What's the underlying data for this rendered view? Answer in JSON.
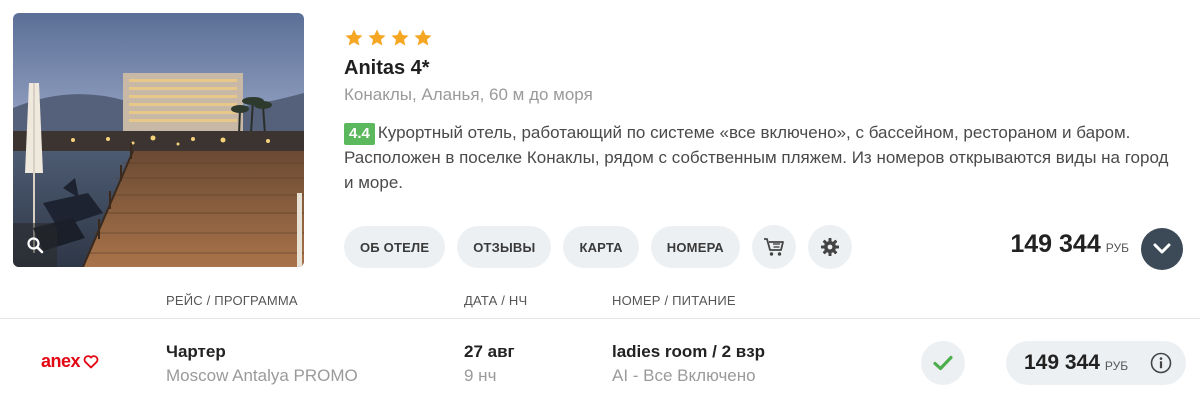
{
  "hotel": {
    "stars": 4,
    "name": "Anitas 4*",
    "location": "Конаклы, Аланья, 60 м до моря",
    "rating": "4.4",
    "description": "Курортный отель, работающий по системе «все включено», с бассейном, рестораном и баром. Расположен в поселке Конаклы, рядом с собственным пляжем. Из номеров открываются виды на город и море.",
    "photo_icon": "search-icon"
  },
  "actions": {
    "about": "ОБ ОТЕЛЕ",
    "reviews": "ОТЗЫВЫ",
    "map": "КАРТА",
    "rooms": "НОМЕРА",
    "cart_icon": "cart-icon",
    "settings_icon": "gear-icon"
  },
  "price": {
    "amount": "149 344",
    "currency": "РУБ"
  },
  "columns": {
    "flight": "РЕЙС / ПРОГРАММА",
    "date": "ДАТА / НЧ",
    "room": "НОМЕР / ПИТАНИЕ"
  },
  "offer": {
    "operator": "anex",
    "flight_type": "Чартер",
    "program": "Moscow Antalya PROMO",
    "date": "27 авг",
    "nights": "9 нч",
    "room": "ladies room / 2 взр",
    "meal": "AI - Все Включено",
    "price": "149 344",
    "currency": "РУБ"
  },
  "colors": {
    "star": "#f5a623",
    "rating_bg": "#5cb85c",
    "brand_red": "#e30613",
    "check_green": "#4cae4c",
    "expand_bg": "#3c4a57",
    "pill_bg": "#edf0f3"
  }
}
